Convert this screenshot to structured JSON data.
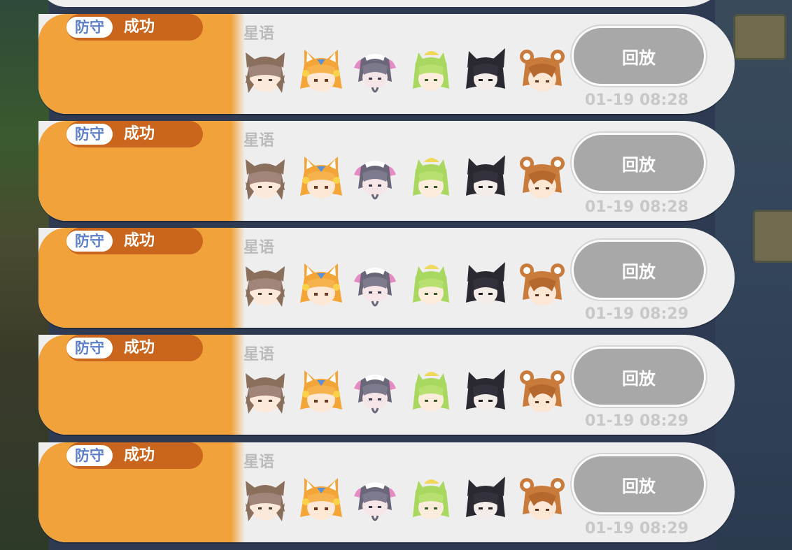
{
  "background": {
    "color": "#2d3a52"
  },
  "colors": {
    "accent_orange": "#f1a23a",
    "tag_brown": "#c9651c",
    "tag_text_blue": "#5b7fc8",
    "button_gray": "#a8a8a8"
  },
  "records": [
    {
      "mode": "防守",
      "result": "成功",
      "player": "星语",
      "replay_label": "回放",
      "time": "01-19 08:28"
    },
    {
      "mode": "防守",
      "result": "成功",
      "player": "星语",
      "replay_label": "回放",
      "time": "01-19 08:28"
    },
    {
      "mode": "防守",
      "result": "成功",
      "player": "星语",
      "replay_label": "回放",
      "time": "01-19 08:29"
    },
    {
      "mode": "防守",
      "result": "成功",
      "player": "星语",
      "replay_label": "回放",
      "time": "01-19 08:29"
    },
    {
      "mode": "防守",
      "result": "成功",
      "player": "星语",
      "replay_label": "回放",
      "time": "01-19 08:29"
    }
  ],
  "team_avatars": [
    "brown-cat-girl-icon",
    "orange-fox-girl-icon",
    "purple-maid-girl-icon",
    "green-hair-girl-icon",
    "black-cat-girl-icon",
    "brown-bear-girl-icon"
  ]
}
